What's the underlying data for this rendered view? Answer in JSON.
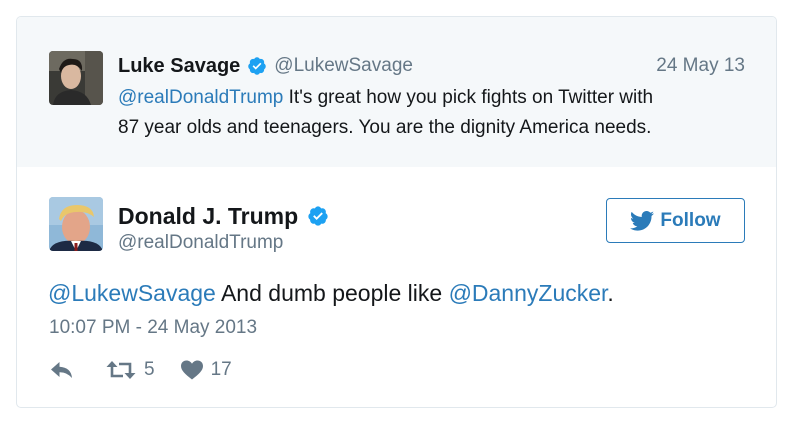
{
  "parent_tweet": {
    "author_name": "Luke Savage",
    "author_handle": "@LukewSavage",
    "date": "24 May 13",
    "mention": "@realDonaldTrump",
    "text_line1": " It's great how you pick fights on Twitter with",
    "text_line2": "87 year olds and teenagers. You are the dignity America needs."
  },
  "main_tweet": {
    "author_name": "Donald J. Trump",
    "author_handle": "@realDonaldTrump",
    "follow_label": "Follow",
    "mention1": "@LukewSavage",
    "text_middle": " And dumb people like ",
    "mention2": "@DannyZucker",
    "text_end": ".",
    "timestamp": "10:07 PM - 24 May 2013",
    "retweet_count": "5",
    "like_count": "17"
  },
  "icons": {
    "verified": "verified-badge-icon",
    "twitter_bird": "twitter-bird-icon",
    "reply": "reply-icon",
    "retweet": "retweet-icon",
    "like": "heart-icon"
  },
  "colors": {
    "link": "#2b7bb9",
    "verified": "#1da1f2",
    "muted": "#657786",
    "parent_background": "#f5f8fa"
  }
}
